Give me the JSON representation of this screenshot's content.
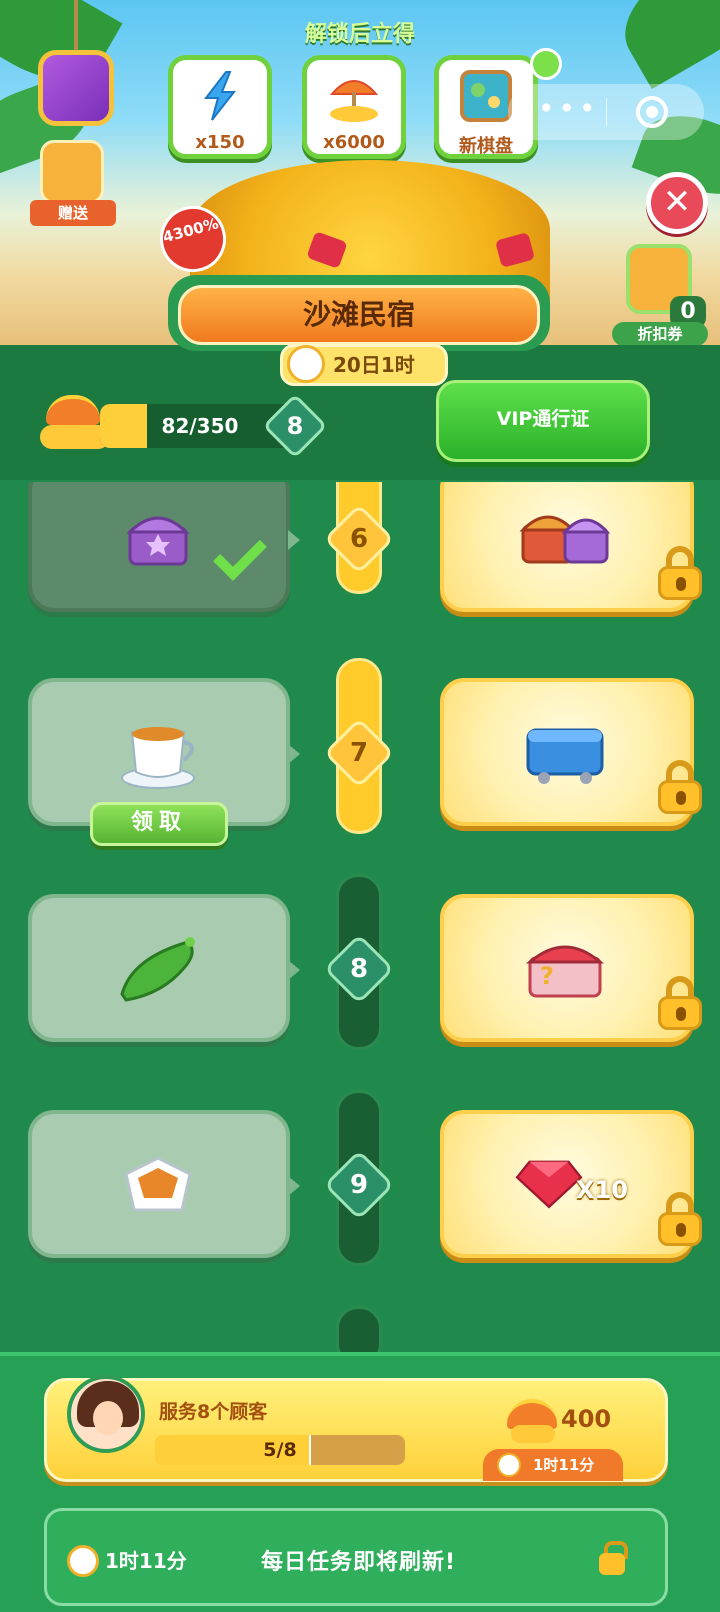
{
  "header": {
    "unlock_title": "解锁后立得",
    "rewards": [
      {
        "label": "x150",
        "icon": "lightning-icon"
      },
      {
        "label": "x6000",
        "icon": "beach-umbrella-icon"
      },
      {
        "label": "新棋盘",
        "icon": "new-board-icon"
      }
    ],
    "gift_label": "赠送",
    "bonus_badge": "4300%",
    "discount": {
      "count": "0",
      "label": "折扣券"
    }
  },
  "event": {
    "title": "沙滩民宿",
    "timer": "20日1时"
  },
  "progress": {
    "text": "82/350",
    "current": 82,
    "max": 350,
    "level": "8",
    "vip_label": "VIP通行证"
  },
  "track": {
    "rows": [
      {
        "level": "6",
        "free_item": "purple-chest-icon",
        "status": "claimed",
        "vip_item": "two-chests-icon",
        "rail_lit": true
      },
      {
        "level": "7",
        "free_item": "tea-cup-icon",
        "status": "claimable",
        "claim_label": "领取",
        "vip_item": "blue-crate-icon",
        "rail_lit": true
      },
      {
        "level": "8",
        "free_item": "cucumber-icon",
        "status": "locked",
        "vip_item": "mystery-chest-icon",
        "rail_lit": false
      },
      {
        "level": "9",
        "free_item": "takeout-box-icon",
        "status": "locked",
        "vip_item": "ruby-icon",
        "vip_qty": "X10",
        "rail_lit": false
      }
    ]
  },
  "task": {
    "name": "服务8个顾客",
    "progress_text": "5/8",
    "current": 5,
    "max": 8,
    "reward": "400",
    "timer": "1时11分"
  },
  "refresh": {
    "timer": "1时11分",
    "message": "每日任务即将刷新!"
  }
}
